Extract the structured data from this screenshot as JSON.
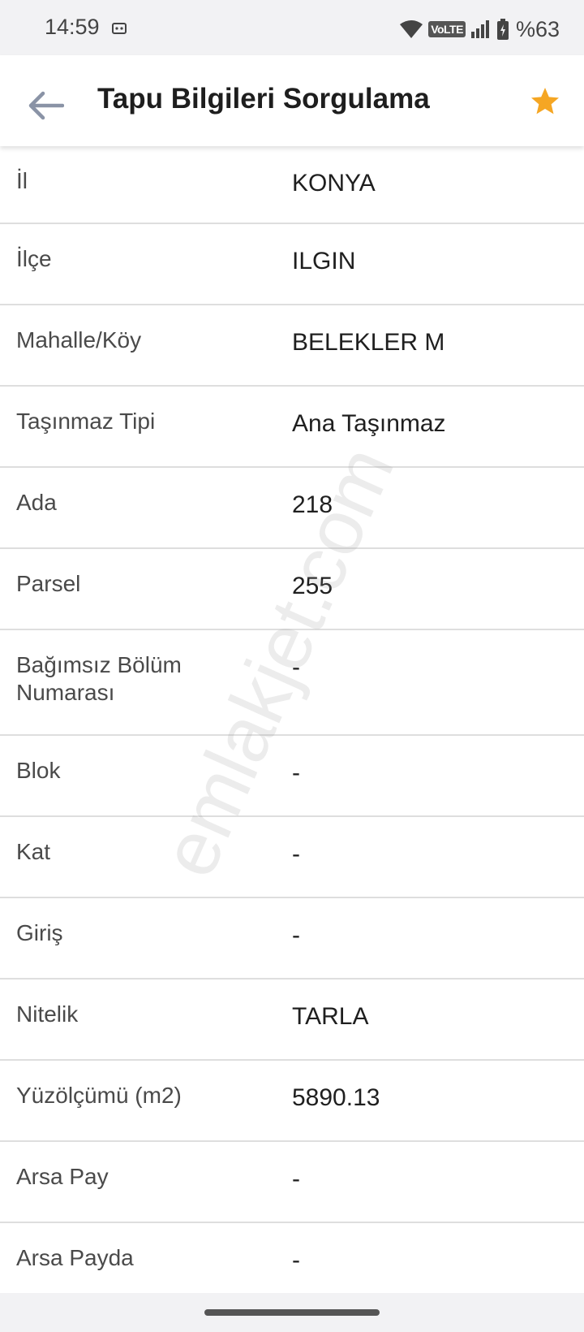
{
  "status_bar": {
    "time": "14:59",
    "network_label": "VoLTE",
    "battery_text": "%63",
    "icons": [
      "cast-icon",
      "wifi-icon",
      "volte-icon",
      "signal-icon",
      "battery-icon"
    ]
  },
  "app_bar": {
    "title": "Tapu Bilgileri Sorgulama",
    "back_icon": "arrow-left-icon",
    "favorite_icon": "star-icon",
    "accent_color": "#f5a623"
  },
  "rows": [
    {
      "label": "İl",
      "value": "KONYA"
    },
    {
      "label": "İlçe",
      "value": "ILGIN"
    },
    {
      "label": "Mahalle/Köy",
      "value": "BELEKLER M"
    },
    {
      "label": "Taşınmaz Tipi",
      "value": "Ana Taşınmaz"
    },
    {
      "label": "Ada",
      "value": "218"
    },
    {
      "label": "Parsel",
      "value": "255"
    },
    {
      "label": "Bağımsız Bölüm Numarası",
      "value": "-"
    },
    {
      "label": "Blok",
      "value": "-"
    },
    {
      "label": "Kat",
      "value": "-"
    },
    {
      "label": "Giriş",
      "value": "-"
    },
    {
      "label": "Nitelik",
      "value": "TARLA"
    },
    {
      "label": "Yüzölçümü (m2)",
      "value": "5890.13"
    },
    {
      "label": "Arsa Pay",
      "value": "-"
    },
    {
      "label": "Arsa Payda",
      "value": "-"
    }
  ],
  "watermark": "emlakjet.com"
}
